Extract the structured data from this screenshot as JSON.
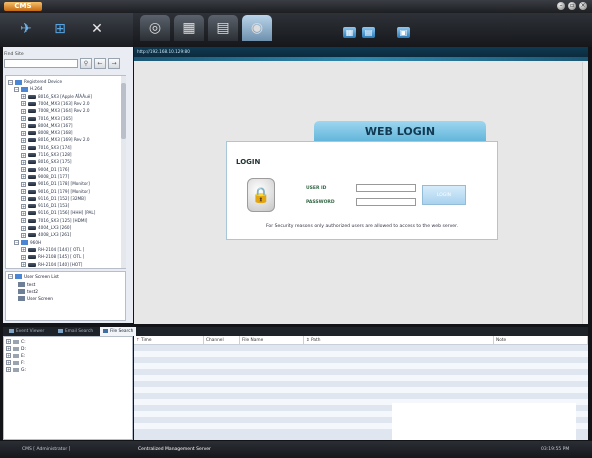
{
  "app": {
    "logo_text": "CMS"
  },
  "window_controls": [
    "minimize",
    "restore",
    "close"
  ],
  "toolbar": {
    "left_icons": [
      "pin-icon",
      "add-device-icon",
      "tools-icon"
    ],
    "tabs": [
      "monitor-icon",
      "playback-icon",
      "setup-icon",
      "web-icon"
    ],
    "small_buttons": [
      "layout-icon",
      "layout-2-icon",
      "export-icon"
    ]
  },
  "find_site": {
    "label": "Find Site",
    "value": "",
    "search_icon": "search-icon",
    "prev_icon": "arrow-left-icon",
    "next_icon": "arrow-right-icon"
  },
  "device_tree": {
    "items": [
      {
        "label": "Registered Device",
        "level": 0,
        "kind": "root"
      },
      {
        "label": "H.264",
        "level": 1,
        "kind": "group"
      },
      {
        "label": "8016_SX3 [Apple ÄÎÁÂuë]",
        "level": 2,
        "kind": "device"
      },
      {
        "label": "7004_MX3 [163] Rev 2.0",
        "level": 2,
        "kind": "device"
      },
      {
        "label": "7008_MX3 [164] Rev 2.0",
        "level": 2,
        "kind": "device"
      },
      {
        "label": "7016_MX3 [165]",
        "level": 2,
        "kind": "device"
      },
      {
        "label": "8004_MX3 [167]",
        "level": 2,
        "kind": "device"
      },
      {
        "label": "8008_MX3 [168]",
        "level": 2,
        "kind": "device"
      },
      {
        "label": "8016_MX3 [169] Rev 2.0",
        "level": 2,
        "kind": "device"
      },
      {
        "label": "7016_SX3 [174]",
        "level": 2,
        "kind": "device"
      },
      {
        "label": "7116_SX3 [128]",
        "level": 2,
        "kind": "device"
      },
      {
        "label": "8016_SX3 [175]",
        "level": 2,
        "kind": "device"
      },
      {
        "label": "9004_D1 [176]",
        "level": 2,
        "kind": "device"
      },
      {
        "label": "9008_D1 [177]",
        "level": 2,
        "kind": "device"
      },
      {
        "label": "9016_D1 [178] [Monitor]",
        "level": 2,
        "kind": "device"
      },
      {
        "label": "9016_D1 [179] [Monitor]",
        "level": 2,
        "kind": "device"
      },
      {
        "label": "9116_D1 [152] [32MB]",
        "level": 2,
        "kind": "device"
      },
      {
        "label": "9116_D1 [153]",
        "level": 2,
        "kind": "device"
      },
      {
        "label": "9116_D1 [156] [HHH] [PAL]",
        "level": 2,
        "kind": "device"
      },
      {
        "label": "7016_SX3 [125] [HDMI]",
        "level": 2,
        "kind": "device"
      },
      {
        "label": "4004_LX3 [260]",
        "level": 2,
        "kind": "device"
      },
      {
        "label": "4008_LX3 [261]",
        "level": 2,
        "kind": "device"
      },
      {
        "label": "960H",
        "level": 1,
        "kind": "group"
      },
      {
        "label": "RH-2104 [144] [ OTL ]",
        "level": 2,
        "kind": "device"
      },
      {
        "label": "RH-2108 [145] [ OTL ]",
        "level": 2,
        "kind": "device"
      },
      {
        "label": "RH-2104 [140] [HOT]",
        "level": 2,
        "kind": "device"
      }
    ]
  },
  "user_screen_list": {
    "title": "User Screen List",
    "items": [
      "test",
      "test2",
      "User Screen"
    ]
  },
  "browser": {
    "url": "http://192.168.10.129:80",
    "login_tab": "WEB LOGIN",
    "heading": "LOGIN",
    "user_id_label": "USER ID",
    "password_label": "PASSWORD",
    "user_id_value": "",
    "password_value": "",
    "login_button": "LOGIN",
    "notice": "For Security reasons only authorized users are allowed to access to the web server."
  },
  "bottom_tabs": [
    "Event Viewer",
    "Email Search",
    "File Search"
  ],
  "active_bottom_tab": "File Search",
  "drives": [
    "C:",
    "D:",
    "E:",
    "F:",
    "G:"
  ],
  "file_grid": {
    "columns": [
      "Time",
      "Channel",
      "File Name",
      "Path",
      "Note"
    ]
  },
  "status": {
    "user": "CMS [ Administrator ]",
    "app_name": "Centralized Management Server",
    "time": "03:19:55 PM"
  },
  "colors": {
    "accent": "#5fb4da",
    "toolbar_bg": "#1c1e22",
    "url_bar_bg": "#0f3a52"
  }
}
